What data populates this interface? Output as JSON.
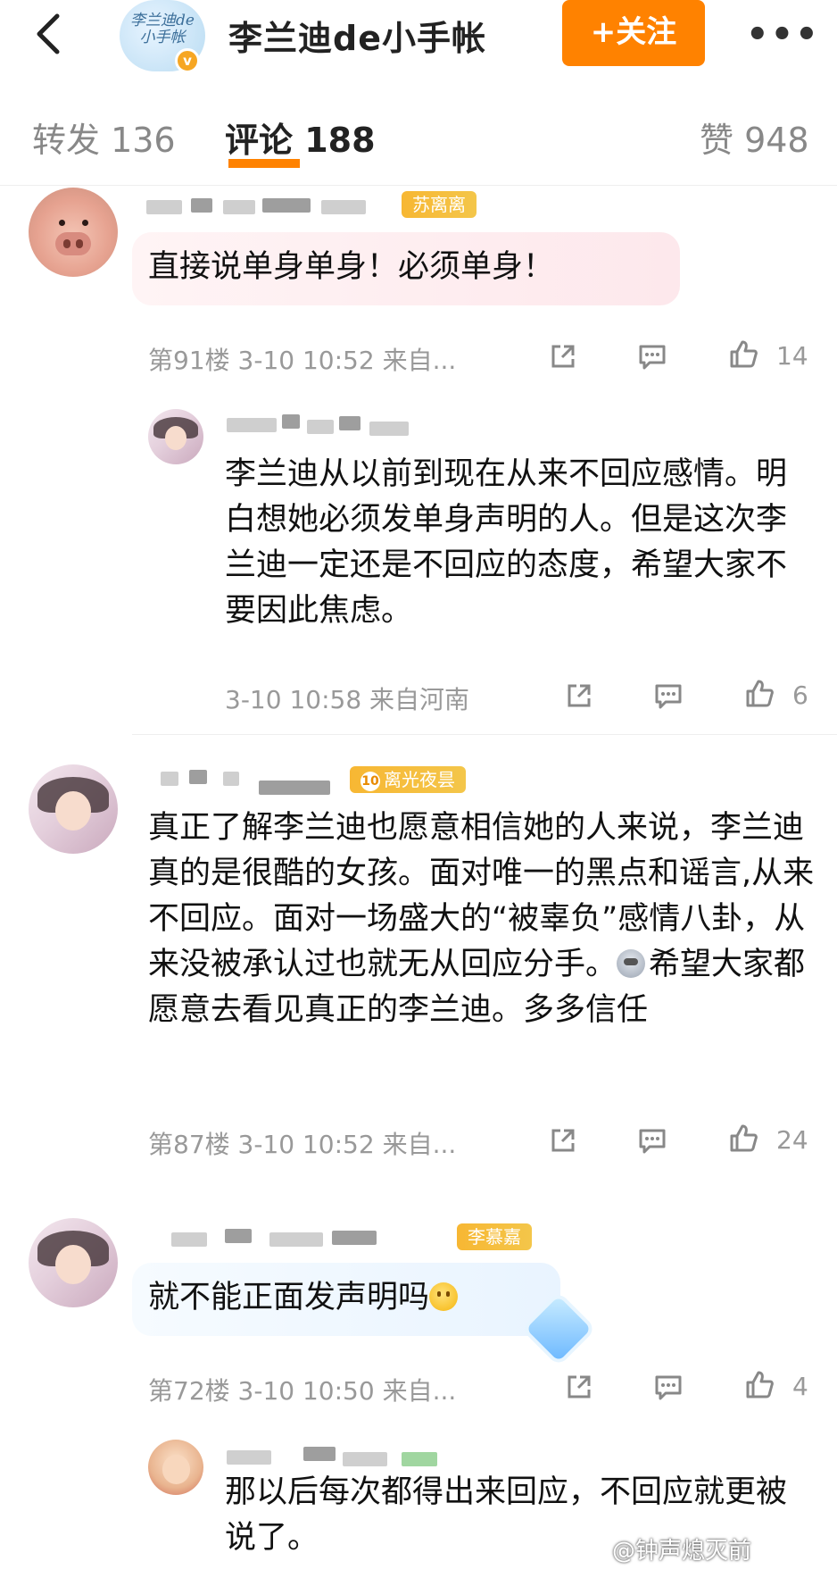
{
  "header": {
    "avatar_text": "李兰迪de小手帐",
    "verify_icon": "v",
    "title": "李兰迪de小手帐",
    "follow_label": "+关注",
    "more_label": "•••"
  },
  "tabs": [
    {
      "label": "转发 136"
    },
    {
      "label": "评论 188"
    },
    {
      "label": "赞 948"
    }
  ],
  "comments": [
    {
      "badge": "苏离离",
      "text": "直接说单身单身！必须单身！",
      "meta": "第91楼  3-10 10:52  来自...",
      "likes": "14"
    },
    {
      "text": "李兰迪从以前到现在从来不回应感情。明白想她必须发单身声明的人。但是这次李兰迪一定还是不回应的态度，希望大家不要因此焦虑。",
      "meta": "3-10 10:58  来自河南",
      "likes": "6"
    },
    {
      "badge_level": "10",
      "badge": "离光夜昙",
      "text_part1": "真正了解李兰迪也愿意相信她的人来说，李兰迪真的是很酷的女孩。面对唯一的黑点和谣言,从来不回应。面对一场盛大的“被辜负”感情八卦，从来没被承认过也就无从回应分手。",
      "text_part2": "希望大家都愿意去看见真正的李兰迪。多多信任",
      "meta": "第87楼  3-10 10:52  来自...",
      "likes": "24"
    },
    {
      "badge": "李慕嘉",
      "text": "就不能正面发声明吗",
      "meta": "第72楼  3-10 10:50  来自...",
      "likes": "4"
    },
    {
      "text": "那以后每次都得出来回应，不回应就更被说了。"
    }
  ],
  "watermark": "@钟声熄灭前"
}
